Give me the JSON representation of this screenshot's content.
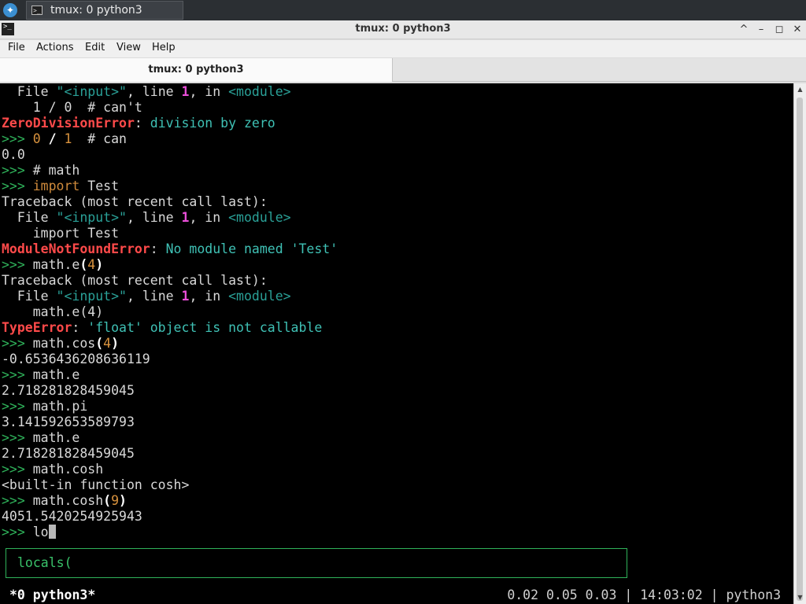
{
  "taskbar": {
    "app_icon": "app-menu-icon",
    "task_label": "tmux: 0 python3"
  },
  "window": {
    "title": "tmux: 0 python3",
    "terminal_icon": "terminal-icon",
    "controls": {
      "minimize": "^",
      "maximize": "–",
      "restore": "◻",
      "close": "✕"
    }
  },
  "menu": [
    "File",
    "Actions",
    "Edit",
    "View",
    "Help"
  ],
  "tab": {
    "label": "tmux: 0 python3"
  },
  "terminal": {
    "lines": [
      [
        {
          "t": "  File "
        },
        {
          "t": "\"<input>\"",
          "c": "str"
        },
        {
          "t": ", line "
        },
        {
          "t": "1",
          "c": "mag"
        },
        {
          "t": ", in "
        },
        {
          "t": "<module>",
          "c": "str"
        }
      ],
      [
        {
          "t": "    1 / 0  # can't"
        }
      ],
      [
        {
          "t": "ZeroDivisionError",
          "c": "err"
        },
        {
          "t": ": "
        },
        {
          "t": "division by zero",
          "c": "msg"
        }
      ],
      [
        {
          "t": ">>> ",
          "c": "prm"
        },
        {
          "t": "0",
          "c": "num"
        },
        {
          "t": " "
        },
        {
          "t": "/",
          "c": "par"
        },
        {
          "t": " "
        },
        {
          "t": "1",
          "c": "num"
        },
        {
          "t": "  # can"
        }
      ],
      [
        {
          "t": "0.0"
        }
      ],
      [
        {
          "t": ">>> ",
          "c": "prm"
        },
        {
          "t": "# math"
        }
      ],
      [
        {
          "t": ">>> ",
          "c": "prm"
        },
        {
          "t": "import",
          "c": "kw"
        },
        {
          "t": " Test"
        }
      ],
      [
        {
          "t": "Traceback (most recent call last):"
        }
      ],
      [
        {
          "t": "  File "
        },
        {
          "t": "\"<input>\"",
          "c": "str"
        },
        {
          "t": ", line "
        },
        {
          "t": "1",
          "c": "mag"
        },
        {
          "t": ", in "
        },
        {
          "t": "<module>",
          "c": "str"
        }
      ],
      [
        {
          "t": "    import Test"
        }
      ],
      [
        {
          "t": "ModuleNotFoundError",
          "c": "err"
        },
        {
          "t": ": "
        },
        {
          "t": "No module named 'Test'",
          "c": "msg"
        }
      ],
      [
        {
          "t": ">>> ",
          "c": "prm"
        },
        {
          "t": "math.e"
        },
        {
          "t": "(",
          "c": "par"
        },
        {
          "t": "4",
          "c": "num"
        },
        {
          "t": ")",
          "c": "par"
        }
      ],
      [
        {
          "t": "Traceback (most recent call last):"
        }
      ],
      [
        {
          "t": "  File "
        },
        {
          "t": "\"<input>\"",
          "c": "str"
        },
        {
          "t": ", line "
        },
        {
          "t": "1",
          "c": "mag"
        },
        {
          "t": ", in "
        },
        {
          "t": "<module>",
          "c": "str"
        }
      ],
      [
        {
          "t": "    math.e(4)"
        }
      ],
      [
        {
          "t": "TypeError",
          "c": "err"
        },
        {
          "t": ": "
        },
        {
          "t": "'float' object is not callable",
          "c": "msg"
        }
      ],
      [
        {
          "t": ">>> ",
          "c": "prm"
        },
        {
          "t": "math.cos"
        },
        {
          "t": "(",
          "c": "par"
        },
        {
          "t": "4",
          "c": "num"
        },
        {
          "t": ")",
          "c": "par"
        }
      ],
      [
        {
          "t": "-0.6536436208636119"
        }
      ],
      [
        {
          "t": ">>> ",
          "c": "prm"
        },
        {
          "t": "math.e"
        }
      ],
      [
        {
          "t": "2.718281828459045"
        }
      ],
      [
        {
          "t": ">>> ",
          "c": "prm"
        },
        {
          "t": "math.pi"
        }
      ],
      [
        {
          "t": "3.141592653589793"
        }
      ],
      [
        {
          "t": ">>> ",
          "c": "prm"
        },
        {
          "t": "math.e"
        }
      ],
      [
        {
          "t": "2.718281828459045"
        }
      ],
      [
        {
          "t": ">>> ",
          "c": "prm"
        },
        {
          "t": "math.cosh"
        }
      ],
      [
        {
          "t": "<built-in function cosh>"
        }
      ],
      [
        {
          "t": ">>> ",
          "c": "prm"
        },
        {
          "t": "math.cosh"
        },
        {
          "t": "(",
          "c": "par"
        },
        {
          "t": "9",
          "c": "num"
        },
        {
          "t": ")",
          "c": "par"
        }
      ],
      [
        {
          "t": "4051.5420254925943"
        }
      ],
      [
        {
          "t": ">>> ",
          "c": "prm"
        },
        {
          "t": "lo"
        },
        {
          "t": "",
          "c": "cursor"
        }
      ]
    ],
    "completion": "locals(",
    "status": {
      "left": "*0 python3*",
      "right": "0.02 0.05 0.03 | 14:03:02 | python3"
    }
  },
  "scrollbar": {
    "up_icon": "scroll-up-arrow-icon",
    "down_icon": "scroll-down-arrow-icon"
  }
}
